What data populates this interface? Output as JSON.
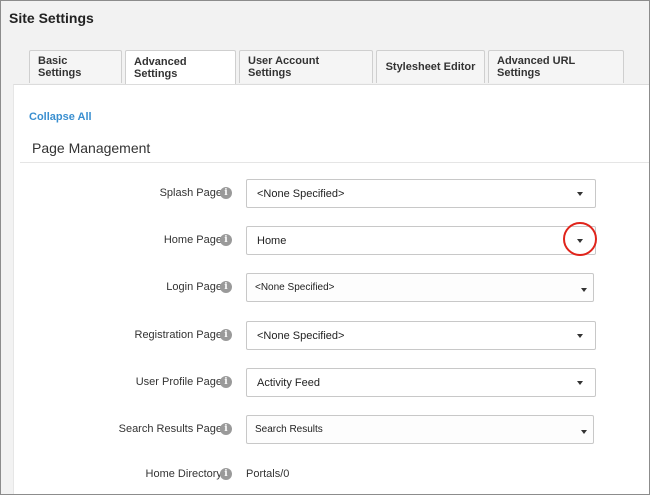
{
  "header": {
    "title": "Site Settings"
  },
  "tabs": [
    {
      "label": "Basic Settings",
      "active": false
    },
    {
      "label": "Advanced Settings",
      "active": true
    },
    {
      "label": "User Account Settings",
      "active": false
    },
    {
      "label": "Stylesheet Editor",
      "active": false
    },
    {
      "label": "Advanced URL Settings",
      "active": false
    }
  ],
  "collapse_all": "Collapse All",
  "section": {
    "title": "Page Management"
  },
  "rows": [
    {
      "label": "Splash Page:",
      "value": "<None Specified>"
    },
    {
      "label": "Home Page:",
      "value": "Home"
    },
    {
      "label": "Login Page:",
      "value": "<None Specified>"
    },
    {
      "label": "Registration Page:",
      "value": "<None Specified>"
    },
    {
      "label": "User Profile Page:",
      "value": "Activity Feed"
    },
    {
      "label": "Search Results Page:",
      "value": "Search Results"
    },
    {
      "label": "Home Directory:",
      "value": "Portals/0"
    }
  ],
  "info_glyph": "i",
  "colors": {
    "link": "#3a8fd0",
    "highlight": "#e0241b",
    "info_icon": "#9a9a9a"
  }
}
